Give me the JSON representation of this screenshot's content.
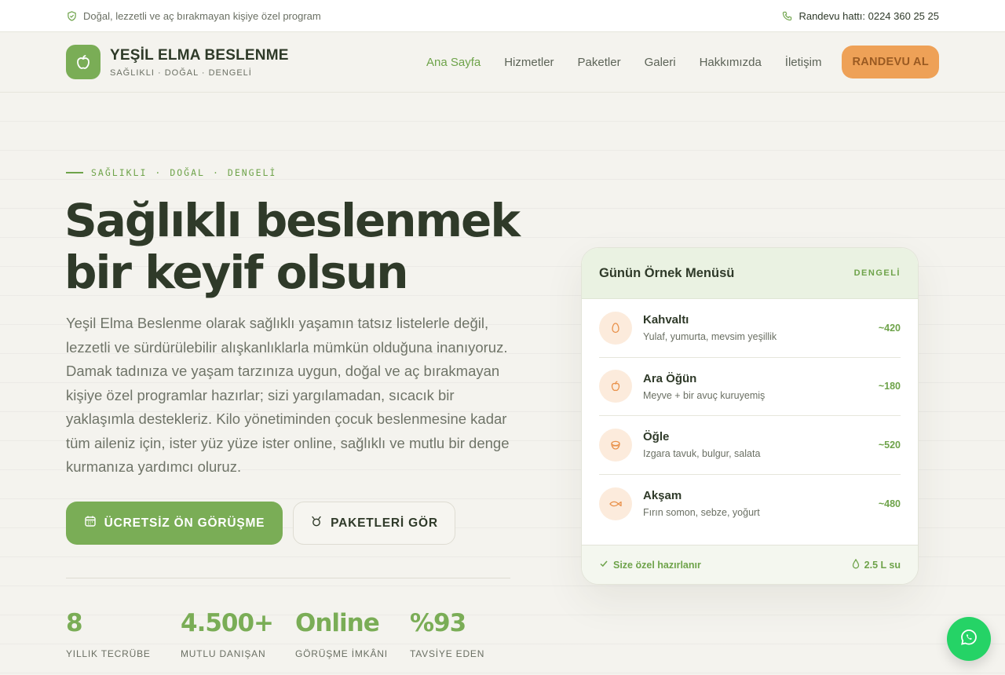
{
  "topbar": {
    "tagline": "Doğal, lezzetli ve aç bırakmayan kişiye özel program",
    "phone_label": "Randevu hattı: 0224 360 25 25"
  },
  "brand": {
    "name": "YEŞİL ELMA BESLENME",
    "tagline": "SAĞLIKLI · DOĞAL · DENGELİ"
  },
  "nav": {
    "items": [
      {
        "label": "Ana Sayfa",
        "active": true
      },
      {
        "label": "Hizmetler"
      },
      {
        "label": "Paketler"
      },
      {
        "label": "Galeri"
      },
      {
        "label": "Hakkımızda"
      },
      {
        "label": "İletişim"
      }
    ],
    "cta": "RANDEVU AL"
  },
  "hero": {
    "eyebrow": [
      "SAĞLIKLI",
      "DOĞAL",
      "DENGELİ"
    ],
    "headline_line1": "Sağlıklı beslenmek",
    "headline_line2": "bir keyif olsun",
    "lead": "Yeşil Elma Beslenme olarak sağlıklı yaşamın tatsız listelerle değil, lezzetli ve sürdürülebilir alışkanlıklarla mümkün olduğuna inanıyoruz. Damak tadınıza ve yaşam tarzınıza uygun, doğal ve aç bırakmayan kişiye özel programlar hazırlar; sizi yargılamadan, sıcacık bir yaklaşımla destekleriz. Kilo yönetiminden çocuk beslenmesine kadar tüm aileniz için, ister yüz yüze ister online, sağlıklı ve mutlu bir denge kurmanıza yardımcı oluruz.",
    "primary_button": "ÜCRETSİZ ÖN GÖRÜŞME",
    "secondary_button": "PAKETLERİ GÖR"
  },
  "stats": [
    {
      "value": "8",
      "label": "YILLIK TECRÜBE"
    },
    {
      "value": "4.500+",
      "label": "MUTLU DANIŞAN"
    },
    {
      "value": "Online",
      "label": "GÖRÜŞME İMKÂNI"
    },
    {
      "value": "%93",
      "label": "TAVSİYE EDEN"
    }
  ],
  "menu_card": {
    "title": "Günün Örnek Menüsü",
    "badge": "DENGELİ",
    "meals": [
      {
        "name": "Kahvaltı",
        "desc": "Yulaf, yumurta, mevsim yeşillik",
        "kcal": "~420",
        "icon": "egg-icon"
      },
      {
        "name": "Ara Öğün",
        "desc": "Meyve + bir avuç kuruyemiş",
        "kcal": "~180",
        "icon": "apple-icon"
      },
      {
        "name": "Öğle",
        "desc": "Izgara tavuk, bulgur, salata",
        "kcal": "~520",
        "icon": "bowl-icon"
      },
      {
        "name": "Akşam",
        "desc": "Fırın somon, sebze, yoğurt",
        "kcal": "~480",
        "icon": "fish-icon"
      }
    ],
    "footer_left": "Size özel hazırlanır",
    "footer_right": "2.5 L su"
  },
  "colors": {
    "accent_green": "#7aad56",
    "cta_orange": "#eea157",
    "whatsapp": "#25d366"
  }
}
